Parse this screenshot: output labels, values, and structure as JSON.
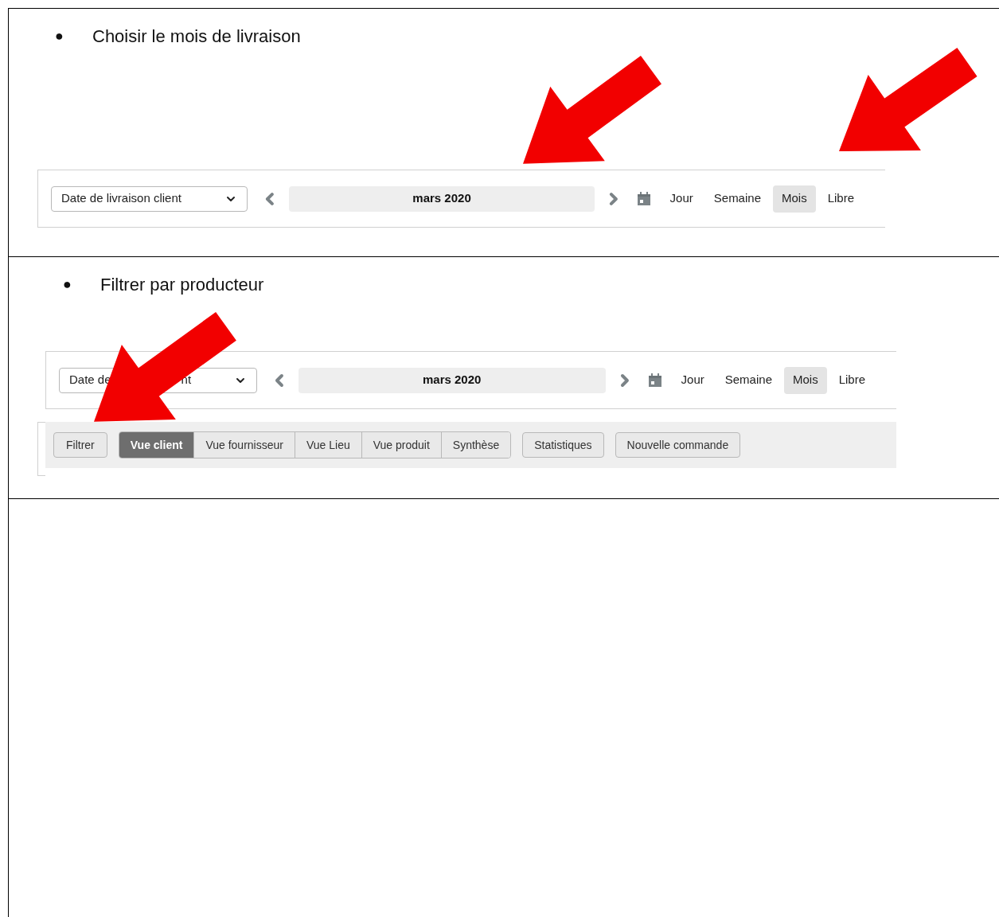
{
  "sections": [
    {
      "bullet": "●",
      "text": "Choisir le mois de livraison",
      "toolbar": {
        "select_value": "Date de livraison client",
        "month": "mars 2020",
        "ranges": [
          {
            "label": "Jour",
            "selected": false
          },
          {
            "label": "Semaine",
            "selected": false
          },
          {
            "label": "Mois",
            "selected": true
          },
          {
            "label": "Libre",
            "selected": false
          }
        ]
      }
    },
    {
      "bullet": "●",
      "text": "Filtrer par producteur",
      "toolbar": {
        "select_value": "Date de",
        "select_value_tail": "nt",
        "month": "mars 2020",
        "ranges": [
          {
            "label": "Jour",
            "selected": false
          },
          {
            "label": "Semaine",
            "selected": false
          },
          {
            "label": "Mois",
            "selected": true
          },
          {
            "label": "Libre",
            "selected": false
          }
        ]
      },
      "action_bar": {
        "filter_button": "Filtrer",
        "views": [
          {
            "label": "Vue client",
            "selected": true
          },
          {
            "label": "Vue fournisseur",
            "selected": false
          },
          {
            "label": "Vue Lieu",
            "selected": false
          },
          {
            "label": "Vue produit",
            "selected": false
          },
          {
            "label": "Synthèse",
            "selected": false
          }
        ],
        "buttons": [
          "Statistiques",
          "Nouvelle commande"
        ]
      }
    }
  ]
}
